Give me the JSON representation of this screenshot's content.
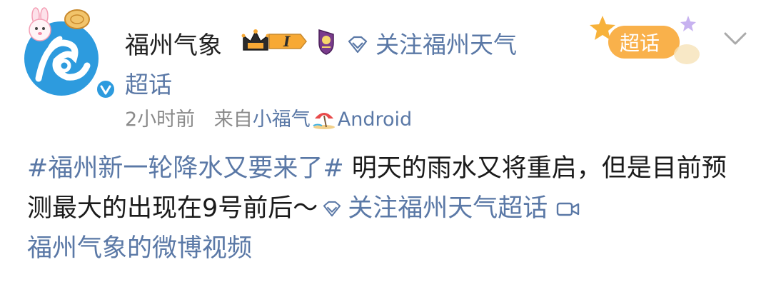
{
  "post": {
    "author": {
      "name": "福州气象",
      "verified": true,
      "avatar": "fuzhou-weather-logo"
    },
    "level_badge": "I",
    "follow_link": {
      "text": "关注福州天气",
      "second_line": "超话",
      "icon": "diamond-icon"
    },
    "meta": {
      "time": "2小时前",
      "source_prefix": "来自",
      "source_name": "小福气",
      "source_icon": "beach-umbrella-icon",
      "platform": "Android"
    },
    "supertopic_badge": "超话",
    "content": {
      "hashtag": "#福州新一轮降水又要来了#",
      "text": " 明天的雨水又将重启，但是目前预测最大的出现在9号前后～",
      "link_text": "关注福州天气超话",
      "video_text": "福州气象的微博视频"
    },
    "colors": {
      "link": "#5a78a6",
      "text": "#1a1a1a",
      "meta": "#8a8a8a",
      "avatar_bg": "#2d9bde",
      "badge_orange": "#f7a935"
    }
  }
}
